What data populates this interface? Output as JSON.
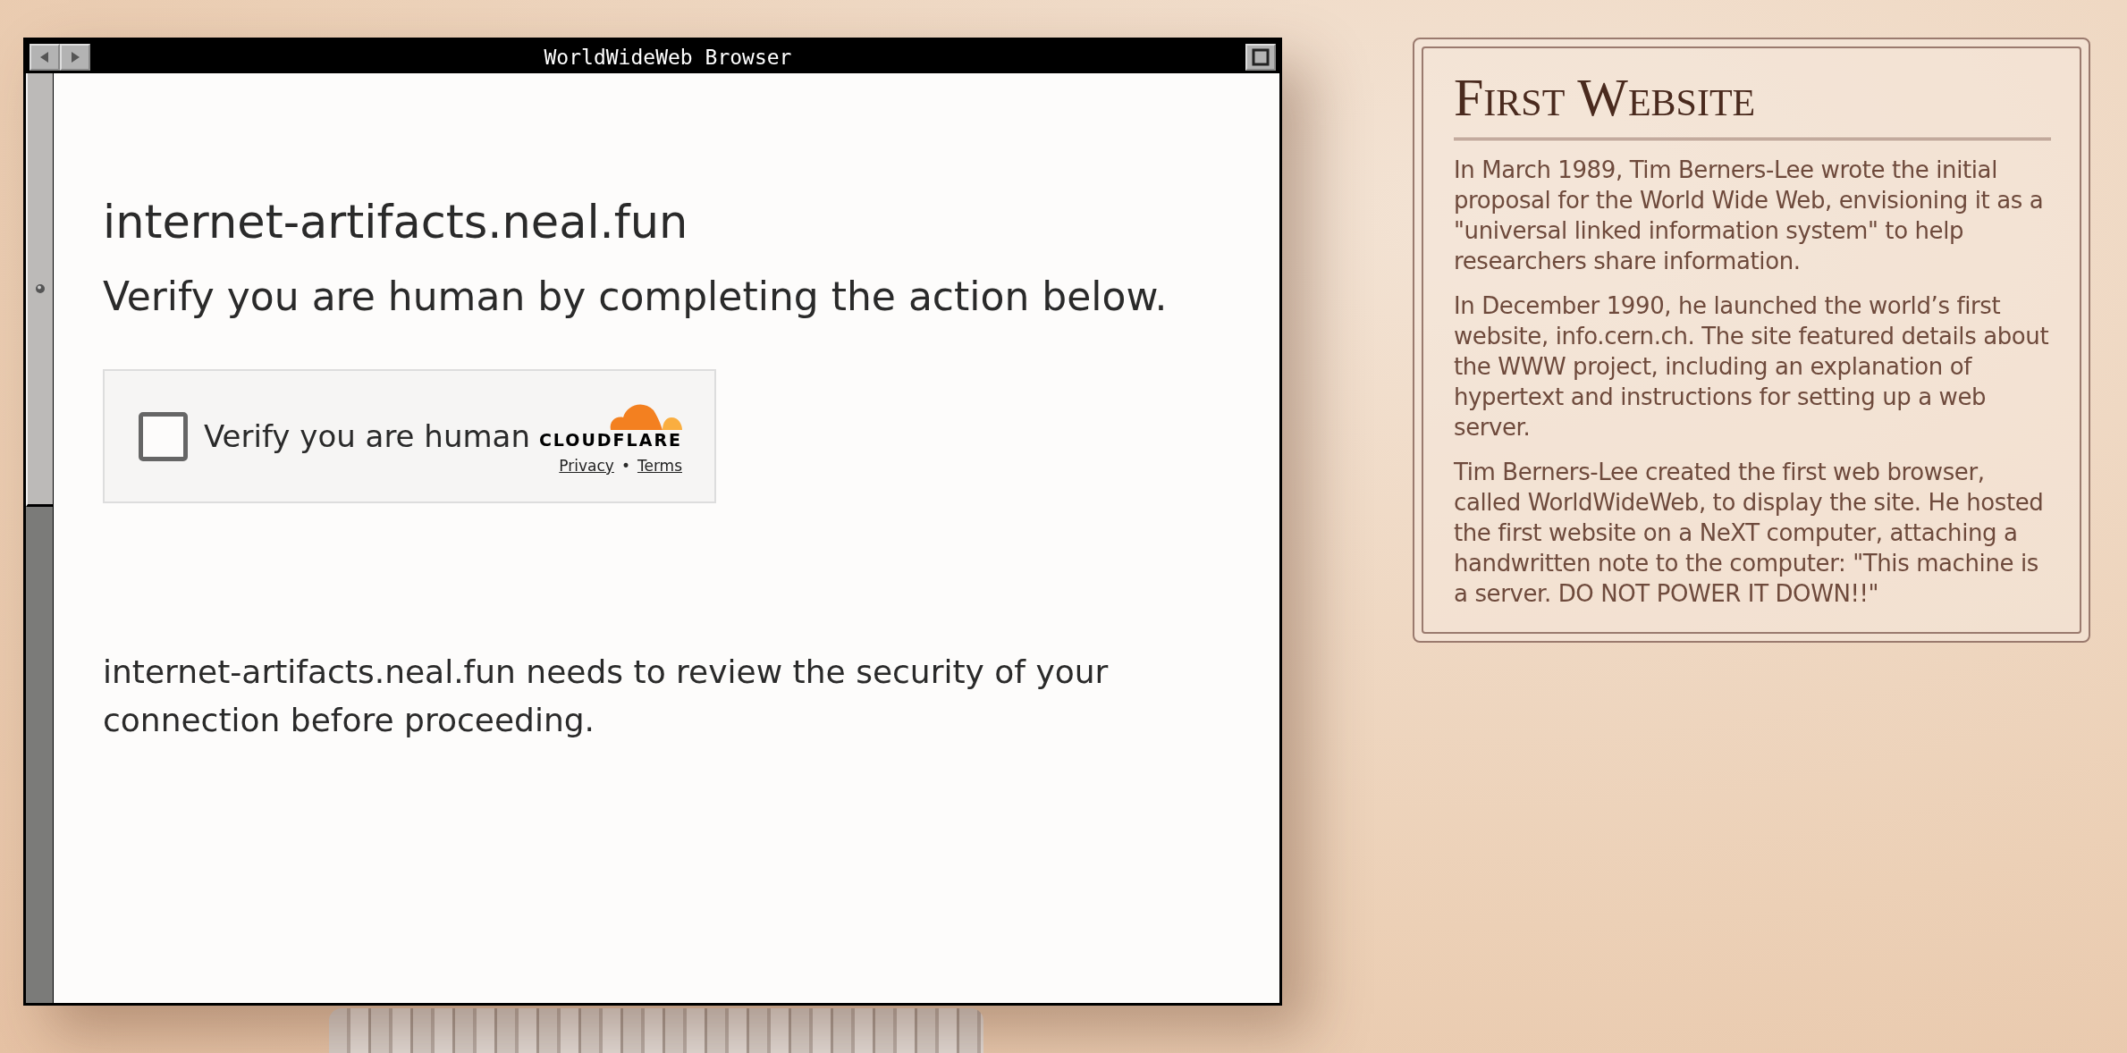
{
  "window": {
    "title": "WorldWideWeb Browser"
  },
  "page": {
    "heading": "internet-artifacts.neal.fun",
    "subheading": "Verify you are human by completing the action below.",
    "challenge": {
      "checked": false,
      "label": "Verify you are human",
      "brand": "CLOUDFLARE",
      "links": [
        "Privacy",
        "Terms"
      ],
      "separator": "•"
    },
    "note": "internet-artifacts.neal.fun needs to review the security of your connection before proceeding."
  },
  "info_panel": {
    "title": "First Website",
    "paragraphs": [
      "In March 1989, Tim Berners-Lee wrote the initial proposal for the World Wide Web, envisioning it as a \"universal linked information system\" to help researchers share information.",
      "In December 1990, he launched the world’s first website, info.cern.ch. The site featured details about the WWW project, including an explanation of hypertext and instructions for setting up a web server.",
      "Tim Berners-Lee created the first web browser, called WorldWideWeb, to display the site. He hosted the first website on a NeXT computer, attaching a handwritten note to the computer: \"This machine is a server. DO NOT POWER IT DOWN!!\""
    ]
  }
}
